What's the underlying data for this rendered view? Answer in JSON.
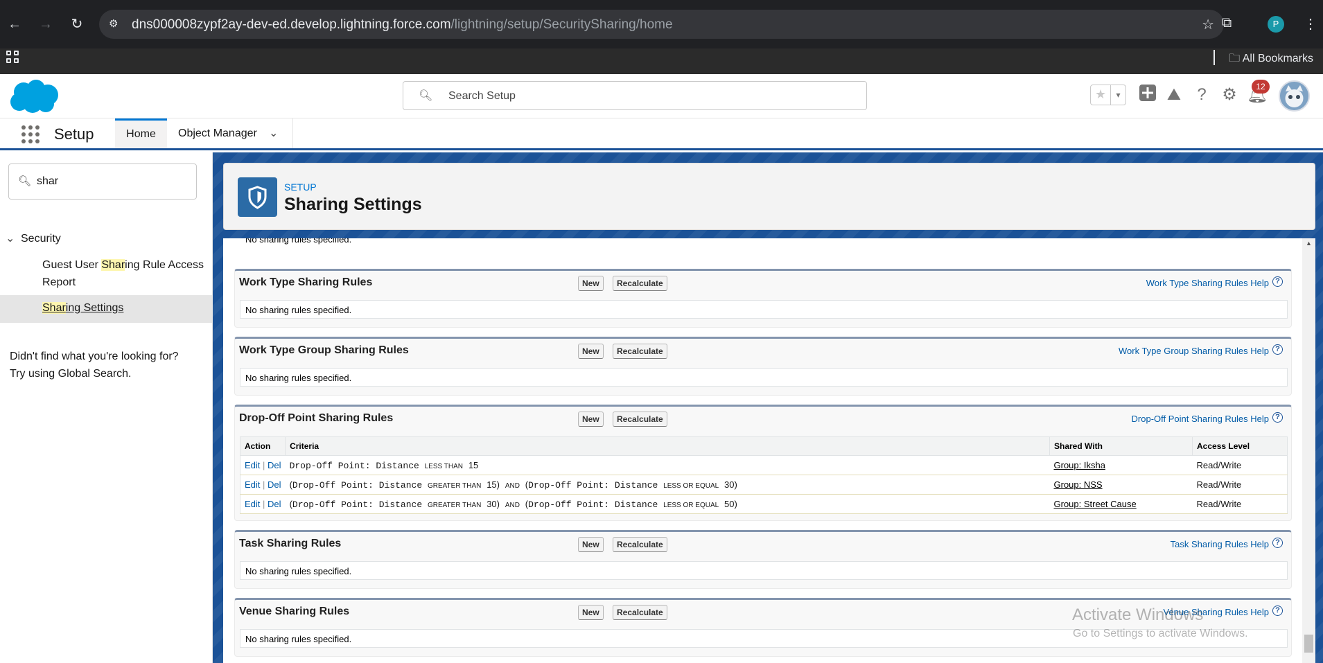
{
  "browser": {
    "url_host": "dns000008zypf2ay-dev-ed.develop.lightning.force.com",
    "url_path": "/lightning/setup/SecuritySharing/home",
    "profile_initial": "P",
    "all_bookmarks": "All Bookmarks"
  },
  "header": {
    "search_placeholder": "Search Setup",
    "notification_count": "12"
  },
  "nav": {
    "app_name": "Setup",
    "tabs": [
      {
        "label": "Home"
      },
      {
        "label": "Object Manager"
      }
    ]
  },
  "sidebar": {
    "quick_find_value": "shar",
    "group_label": "Security",
    "item1": {
      "pre": "Guest User ",
      "hl": "Shar",
      "post": "ing Rule Access Report"
    },
    "item2": {
      "hl": "Shar",
      "post": "ing Settings"
    },
    "not_found_line1": "Didn't find what you're looking for?",
    "not_found_line2": "Try using Global Search."
  },
  "page_header": {
    "eyebrow": "SETUP",
    "title": "Sharing Settings"
  },
  "content": {
    "top_cut_text": "No sharing rules specified.",
    "new_label": "New",
    "recalc_label": "Recalculate",
    "empty_text": "No sharing rules specified.",
    "sections": [
      {
        "title": "Work Type Sharing Rules",
        "help": "Work Type Sharing Rules Help"
      },
      {
        "title": "Work Type Group Sharing Rules",
        "help": "Work Type Group Sharing Rules Help"
      },
      {
        "title": "Drop-Off Point Sharing Rules",
        "help": "Drop-Off Point Sharing Rules Help"
      },
      {
        "title": "Task Sharing Rules",
        "help": "Task Sharing Rules Help"
      },
      {
        "title": "Venue Sharing Rules",
        "help": "Venue Sharing Rules Help"
      }
    ],
    "table": {
      "headers": [
        "Action",
        "Criteria",
        "Shared With",
        "Access Level"
      ],
      "edit": "Edit",
      "del": "Del",
      "field": "Drop-Off Point: Distance",
      "ops": {
        "lt": "LESS THAN",
        "gt": "GREATER THAN",
        "le": "LESS OR EQUAL",
        "and": "AND"
      },
      "rows": [
        {
          "v1": "15",
          "v2": "",
          "group": "Group: Iksha",
          "access": "Read/Write"
        },
        {
          "v1": "15",
          "v2": "30",
          "group": "Group: NSS",
          "access": "Read/Write"
        },
        {
          "v1": "30",
          "v2": "50",
          "group": "Group: Street Cause",
          "access": "Read/Write"
        }
      ]
    }
  },
  "watermark": {
    "line1": "Activate Windows",
    "line2": "Go to Settings to activate Windows."
  }
}
